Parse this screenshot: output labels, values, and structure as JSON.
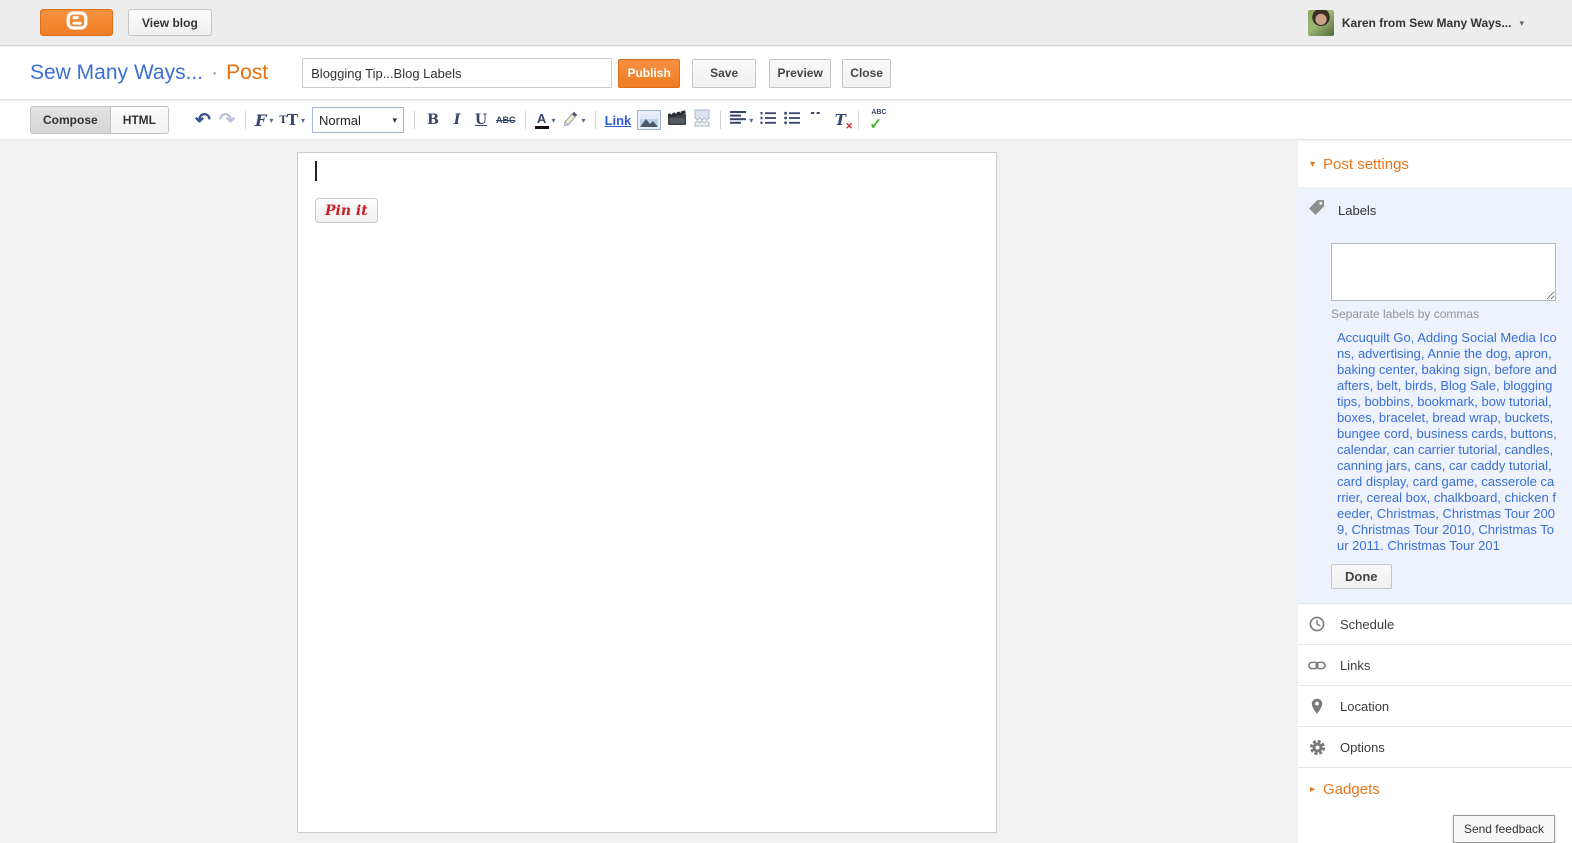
{
  "topbar": {
    "view_blog": "View blog",
    "user_name": "Karen from Sew Many Ways..."
  },
  "header": {
    "blog_name": "Sew Many Ways...",
    "separator": "·",
    "page_type": "Post",
    "title_value": "Blogging Tip...Blog Labels",
    "publish": "Publish",
    "save": "Save",
    "preview": "Preview",
    "close": "Close"
  },
  "toolbar": {
    "compose": "Compose",
    "html": "HTML",
    "font_style_selected": "Normal",
    "bold": "B",
    "italic": "I",
    "underline": "U",
    "strike": "ABC",
    "textcolor": "A",
    "link": "Link",
    "clear_t": "T",
    "clear_x": "✕",
    "spell": "ABC"
  },
  "icons": {
    "undo": "↶",
    "redo": "↷",
    "dropdown": "▾",
    "expand_down": "▾",
    "expand_right": "▸",
    "font": "F",
    "size_small": "T",
    "size_big": "T",
    "quote": "“"
  },
  "editor": {
    "pin_it": "Pin it"
  },
  "sidebar": {
    "post_settings": "Post settings",
    "labels": {
      "title": "Labels",
      "textarea_value": "",
      "hint": "Separate labels by commas",
      "links_text": "Accuquilt Go, Adding Social Media Icons, advertising, Annie the dog, apron, baking center, baking sign, before and afters, belt, birds, Blog Sale, blogging tips, bobbins, bookmark, bow tutorial, boxes, bracelet, bread wrap, buckets, bungee cord, business cards, buttons, calendar, can carrier tutorial, candles, canning jars, cans, car caddy tutorial, card display, card game, casserole carrier, cereal box, chalkboard, chicken feeder, Christmas, Christmas Tour 2009, Christmas Tour 2010, Christmas Tour 2011. Christmas Tour 201",
      "done": "Done"
    },
    "items": [
      {
        "label": "Schedule"
      },
      {
        "label": "Links"
      },
      {
        "label": "Location"
      },
      {
        "label": "Options"
      }
    ],
    "gadgets": "Gadgets"
  },
  "feedback": "Send feedback",
  "colors": {
    "accent_orange": "#ee7f26",
    "orange_text": "#e8710a",
    "blog_blue": "#3a6fd3",
    "labels_link_blue": "#3b6fd6",
    "labels_panel_bg": "#edf2fc"
  }
}
